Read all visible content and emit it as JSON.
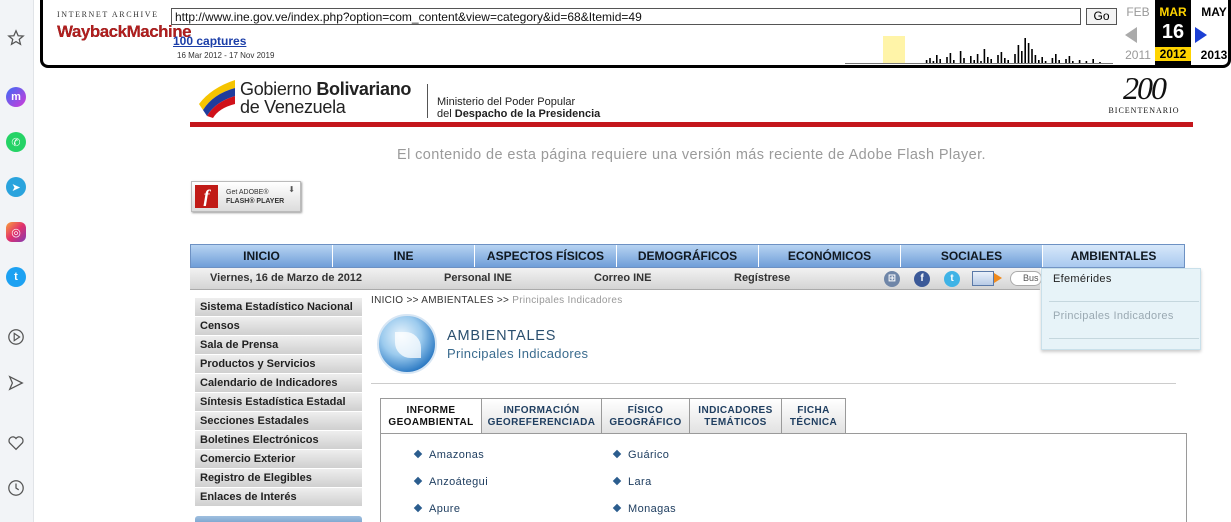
{
  "wayback": {
    "logo_top": "INTERNET ARCHIVE",
    "logo_main": "WaybackMachine",
    "url": "http://www.ine.gov.ve/index.php?option=com_content&view=category&id=68&Itemid=49",
    "go_label": "Go",
    "captures": "100 captures",
    "date_range": "16 Mar 2012 - 17 Nov 2019",
    "prev_month": "FEB",
    "cur_month": "MAR",
    "next_month": "MAY",
    "cur_day": "16",
    "prev_year": "2011",
    "cur_year": "2012",
    "next_year": "2013"
  },
  "header": {
    "gov_line1_a": "Gobierno ",
    "gov_line1_b": "Bolivariano",
    "gov_line2": "de Venezuela",
    "ministry_line1": "Ministerio del Poder Popular",
    "ministry_line2a": "del ",
    "ministry_line2b": "Despacho de la Presidencia",
    "bicentenario_num": "200",
    "bicentenario_label": "BICENTENARIO"
  },
  "flash": {
    "message": "El contenido de esta página requiere una versión más reciente de Adobe Flash Player.",
    "badge_line1": "Get ADOBE®",
    "badge_line2": "FLASH® PLAYER"
  },
  "mainnav": [
    "INICIO",
    "INE",
    "ASPECTOS FÍSICOS",
    "DEMOGRÁFICOS",
    "ECONÓMICOS",
    "SOCIALES",
    "AMBIENTALES"
  ],
  "subbar": {
    "date": "Viernes, 16 de Marzo de 2012",
    "personal": "Personal INE",
    "correo": "Correo INE",
    "registrese": "Regístrese",
    "search_placeholder": "Bus"
  },
  "dropdown": {
    "item1": "Efemérides",
    "item2": "Principales Indicadores"
  },
  "sidebar": [
    "Sistema Estadístico Nacional",
    "Censos",
    "Sala de Prensa",
    "Productos y Servicios",
    "Calendario de Indicadores",
    "Síntesis Estadística Estadal",
    "Secciones Estadales",
    "Boletines Electrónicos",
    "Comercio Exterior",
    "Registro de Elegibles",
    "Enlaces de Interés"
  ],
  "breadcrumb": {
    "home": "INICIO",
    "section": "AMBIENTALES",
    "current": "Principales Indicadores",
    "sep": " >> "
  },
  "section": {
    "title": "AMBIENTALES",
    "subtitle": "Principales Indicadores"
  },
  "tabs": [
    {
      "line1": "INFORME",
      "line2": "GEOAMBIENTAL"
    },
    {
      "line1": "INFORMACIÓN",
      "line2": "GEOREFERENCIADA"
    },
    {
      "line1": "FÍSICO",
      "line2": "GEOGRÁFICO"
    },
    {
      "line1": "INDICADORES",
      "line2": "TEMÁTICOS"
    },
    {
      "line1": "FICHA",
      "line2": "TÉCNICA"
    }
  ],
  "states_col1": [
    "Amazonas",
    "Anzoátegui",
    "Apure"
  ],
  "states_col2": [
    "Guárico",
    "Lara",
    "Monagas"
  ],
  "colors": {
    "accent_red": "#c4161c",
    "nav_blue": "#6f9ed8",
    "link_blue": "#1f3e60"
  }
}
